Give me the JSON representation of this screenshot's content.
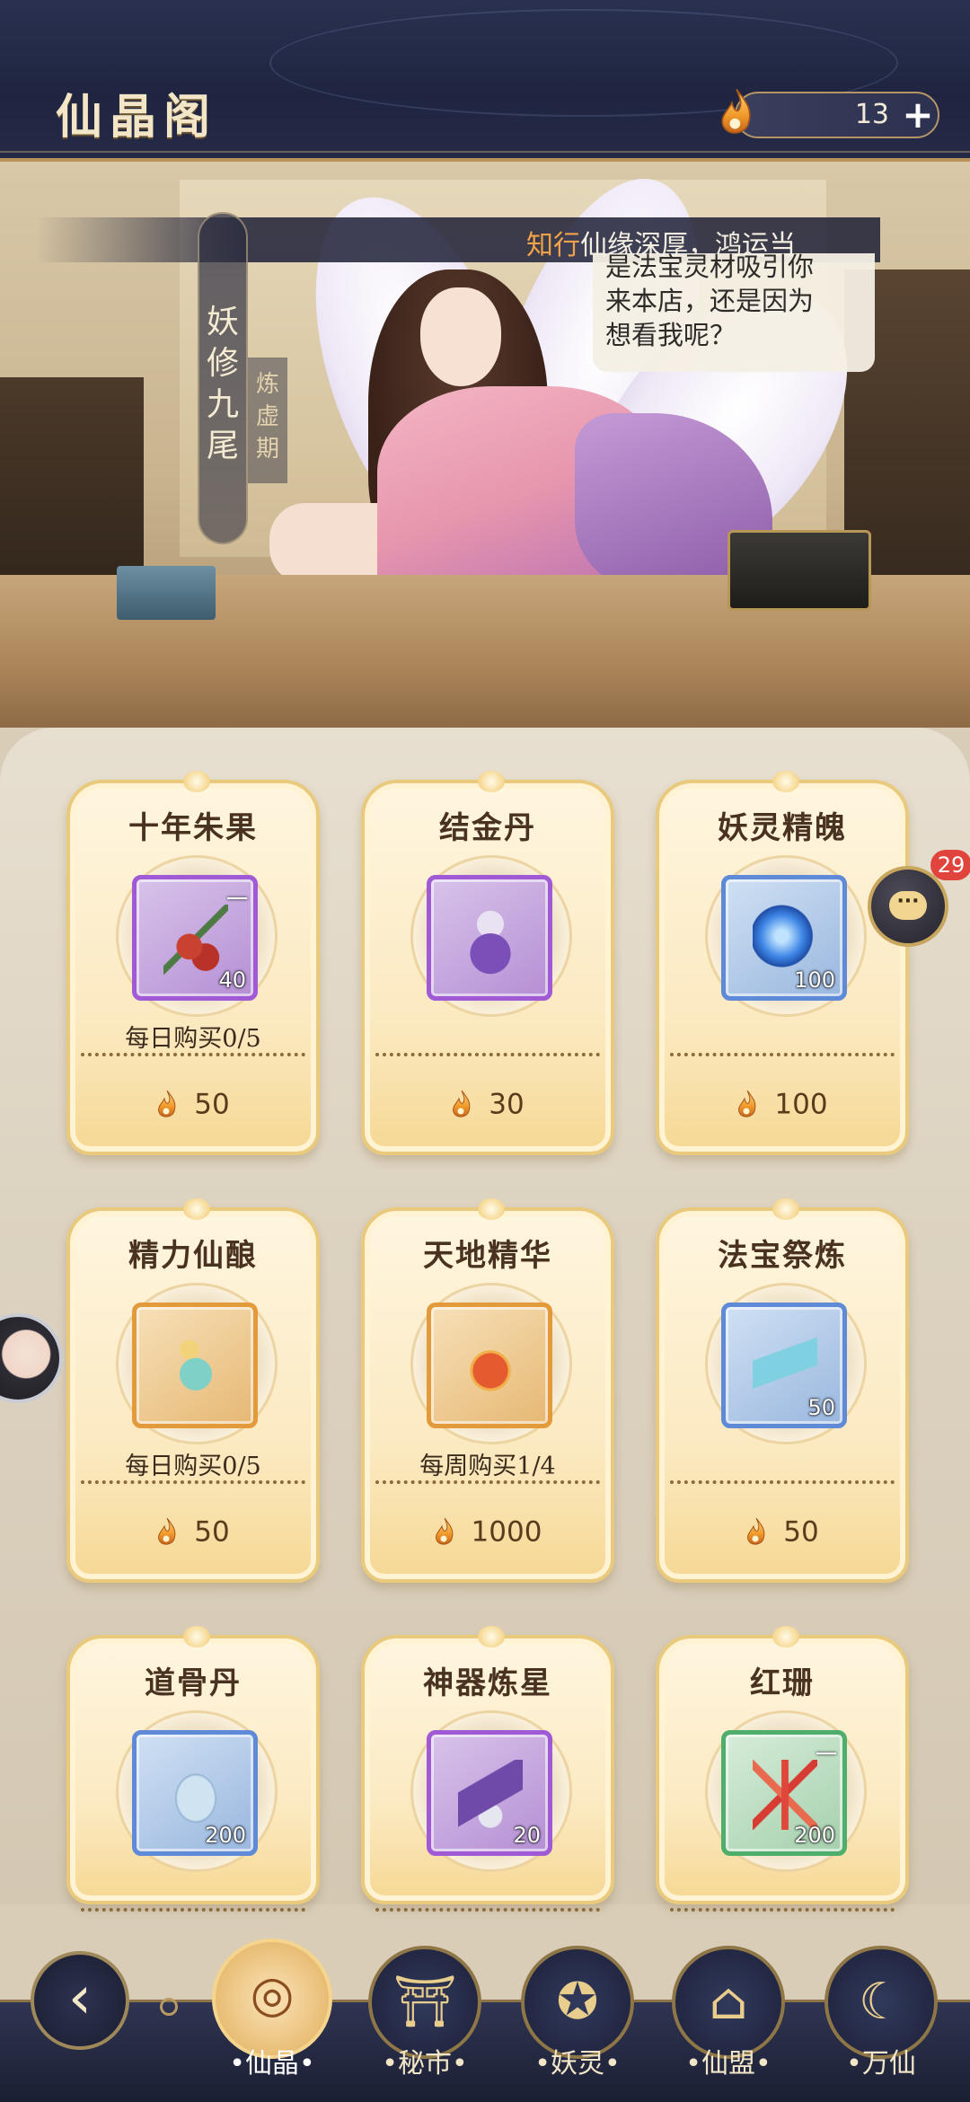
{
  "header": {
    "title": "仙晶阁",
    "currency": {
      "icon": "spirit-flame-icon",
      "amount": "13",
      "add_label": "+"
    }
  },
  "npc": {
    "name": "妖修九尾",
    "realm": "炼虚期",
    "dialogue_speaker": "知行",
    "dialogue_line": "仙缘深厚，鸿运当",
    "speech": "是法宝灵材吸引你\n来本店，还是因为\n想看我呢？"
  },
  "shop": {
    "items": [
      {
        "name": "十年朱果",
        "quantity": "40",
        "limit": "每日购买0/5",
        "price": "50",
        "quality": "purple",
        "icon": "red-berry-branch-icon",
        "corner_mark": "一"
      },
      {
        "name": "结金丹",
        "quantity": "",
        "limit": "",
        "price": "30",
        "quality": "purple",
        "icon": "pill-gourd-icon",
        "corner_mark": ""
      },
      {
        "name": "妖灵精魄",
        "quantity": "100",
        "limit": "",
        "price": "100",
        "quality": "blue",
        "icon": "blue-spirit-orb-icon",
        "corner_mark": ""
      },
      {
        "name": "精力仙酿",
        "quantity": "",
        "limit": "每日购买0/5",
        "price": "50",
        "quality": "orange",
        "icon": "wine-ewer-icon",
        "corner_mark": ""
      },
      {
        "name": "天地精华",
        "quantity": "",
        "limit": "每周购买1/4",
        "price": "1000",
        "quality": "orange",
        "icon": "essence-pouch-icon",
        "corner_mark": ""
      },
      {
        "name": "法宝祭炼",
        "quantity": "50",
        "limit": "",
        "price": "50",
        "quality": "blue",
        "icon": "jade-talisman-icon",
        "corner_mark": ""
      },
      {
        "name": "道骨丹",
        "quantity": "200",
        "limit": "",
        "price": "",
        "quality": "blue",
        "icon": "bone-egg-icon",
        "corner_mark": ""
      },
      {
        "name": "神器炼星",
        "quantity": "20",
        "limit": "",
        "price": "",
        "quality": "purple",
        "icon": "forge-crystal-icon",
        "corner_mark": ""
      },
      {
        "name": "红珊",
        "quantity": "200",
        "limit": "",
        "price": "",
        "quality": "green",
        "icon": "red-coral-icon",
        "corner_mark": "一"
      }
    ]
  },
  "chat": {
    "icon": "chat-bubble-icon",
    "badge": "29",
    "dots": "···"
  },
  "nav": {
    "back_icon": "back-arrow-icon",
    "tabs": [
      {
        "label": "•仙晶•",
        "icon": "crystal-pavilion-icon",
        "glyph": "◎",
        "active": true
      },
      {
        "label": "•秘市•",
        "icon": "market-gate-icon",
        "glyph": "⛩",
        "active": false
      },
      {
        "label": "•妖灵•",
        "icon": "fox-spirit-icon",
        "glyph": "✪",
        "active": false
      },
      {
        "label": "•仙盟•",
        "icon": "alliance-gate-icon",
        "glyph": "⌂",
        "active": false
      },
      {
        "label": "•万仙",
        "icon": "immortal-hall-icon",
        "glyph": "☾",
        "active": false
      }
    ]
  },
  "colors": {
    "header_bg": "#1f2540",
    "card_border": "#e9c97b",
    "quality_purple": "#a15ad6",
    "quality_blue": "#5f8ad8",
    "quality_orange": "#e39a3b",
    "quality_green": "#4fae6b",
    "badge_red": "#e0443c",
    "speaker_orange": "#f2a24a"
  }
}
